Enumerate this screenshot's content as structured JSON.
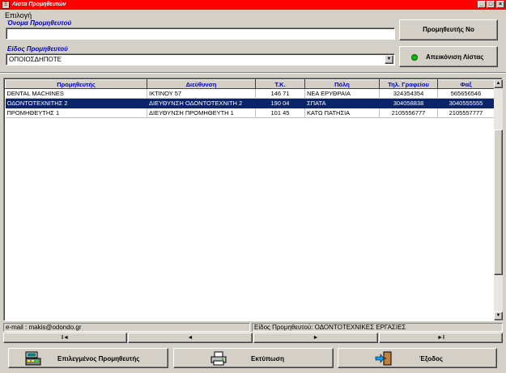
{
  "window": {
    "title": "Λίστα Προμηθευτών"
  },
  "filter": {
    "section_label": "Επιλογή",
    "name_label": "Όνομα Προμηθευτού",
    "name_value": "",
    "type_label": "Είδος Προμηθευτού",
    "type_value": "ΟΠΟΙΟΣΔΗΠΟΤΕ",
    "supplier_no_button": "Προμηθευτής Νο",
    "show_list_button": "Απεικόνιση Λίστας"
  },
  "grid": {
    "columns": [
      "Προμηθευτής",
      "Διεύθυνση",
      "Τ.Κ.",
      "Πόλη",
      "Τηλ. Γραφείου",
      "Φαξ"
    ],
    "rows": [
      [
        "DENTAL MACHINES",
        "ΙΚΤΙΝΟΥ 57",
        "146 71",
        "ΝΕΑ ΕΡΥΘΡΑΙΑ",
        "324354354",
        "565656546"
      ],
      [
        "ΟΔΟΝΤΟΤΕΧΝΙΤΗΣ 2",
        "ΔΙΕΥΘΥΝΣΗ ΟΔΟΝΤΟΤΕΧΝΙΤΗ 2",
        "190 04",
        "ΣΠΑΤΑ",
        "304058838",
        "3040555555"
      ],
      [
        "ΠΡΟΜΗΘΕΥΤΗΣ 1",
        "ΔΙΕΥΘΥΝΣΗ ΠΡΟΜΗΘΕΥΤΗ 1",
        "101 45",
        "ΚΑΤΩ ΠΑΤΗΣΙΑ",
        "2105556777",
        "2105557777"
      ]
    ],
    "selected_row": 1
  },
  "status": {
    "email": "e-mail : makis@odondo.gr",
    "type": "Είδος Προμηθευτού: ΟΔΟΝΤΟΤΕΧΝΙΚΕΣ ΕΡΓΑΣΙΕΣ"
  },
  "nav": {
    "first": "I◄",
    "prev": "◄",
    "next": "►",
    "last": "►I"
  },
  "footer": {
    "selected_supplier": "Επιλεγμένος Προμηθευτής",
    "print": "Εκτύπωση",
    "exit": "Έξοδος"
  },
  "colors": {
    "titlebar": "#ff0000",
    "label_blue": "#0000c0",
    "selection": "#0a246a",
    "led_green": "#00c000"
  }
}
